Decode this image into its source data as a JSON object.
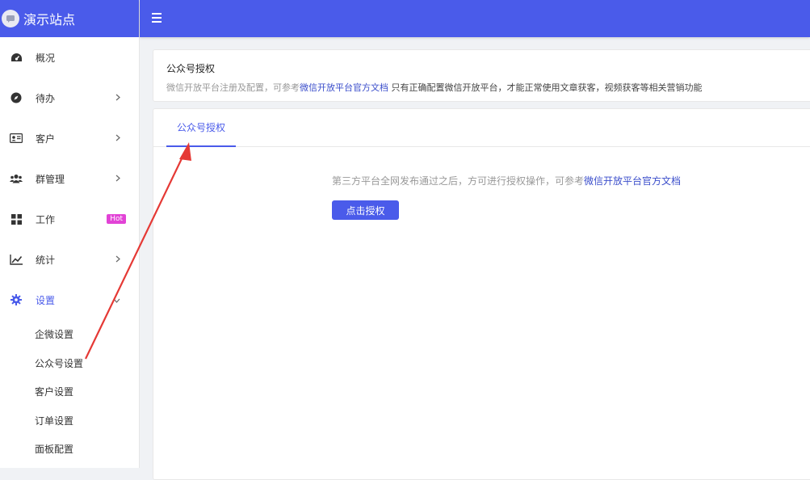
{
  "brand": {
    "title": "演示站点"
  },
  "sidebar": {
    "items": [
      {
        "label": "概况",
        "icon": "dashboard-icon",
        "chevron": false
      },
      {
        "label": "待办",
        "icon": "compass-icon",
        "chevron": true
      },
      {
        "label": "客户",
        "icon": "id-card-icon",
        "chevron": true
      },
      {
        "label": "群管理",
        "icon": "users-icon",
        "chevron": true
      },
      {
        "label": "工作",
        "icon": "grid-icon",
        "badge": "Hot"
      },
      {
        "label": "统计",
        "icon": "chart-line-icon",
        "chevron": true
      },
      {
        "label": "设置",
        "icon": "gear-icon",
        "expanded": true
      }
    ],
    "submenu": [
      {
        "label": "企微设置"
      },
      {
        "label": "公众号设置"
      },
      {
        "label": "客户设置"
      },
      {
        "label": "订单设置"
      },
      {
        "label": "面板配置"
      }
    ]
  },
  "notice": {
    "title": "公众号授权",
    "desc_prefix": "微信开放平台注册及配置，可参考",
    "desc_link": "微信开放平台官方文档",
    "desc_suffix": " 只有正确配置微信开放平台，才能正常使用文章获客，视频获客等相关营销功能"
  },
  "panel": {
    "tab_label": "公众号授权",
    "hint_text": "第三方平台全网发布通过之后，方可进行授权操作，可参考",
    "hint_link": "微信开放平台官方文档",
    "button_label": "点击授权"
  },
  "colors": {
    "primary": "#4a5bea",
    "hot_badge": "#e243d6",
    "annotation_arrow": "#e53935"
  }
}
